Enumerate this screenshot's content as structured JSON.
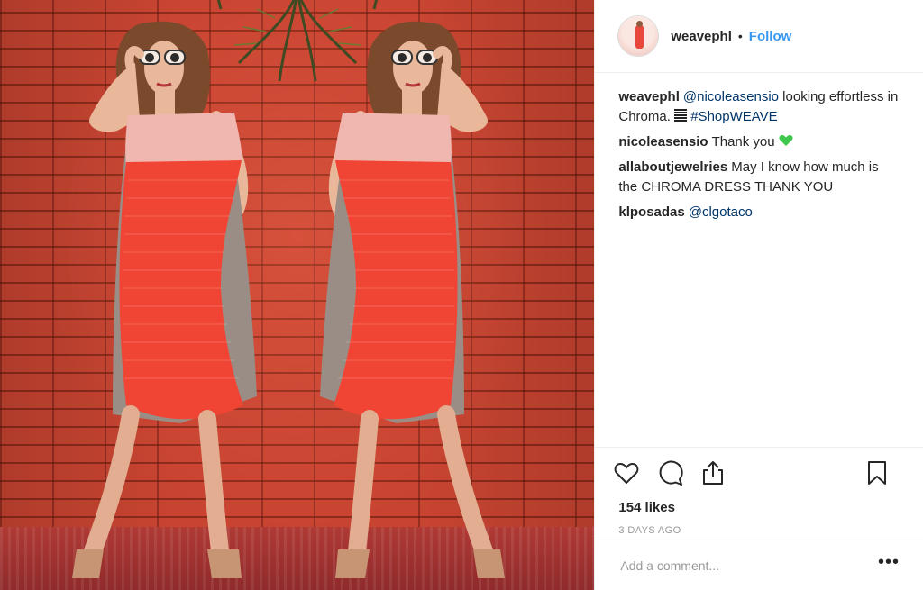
{
  "post": {
    "username": "weavephl",
    "follow_label": "Follow",
    "separator": "•",
    "photo_alt": "Woman in a red and grey pleated dress, mirrored, in front of a red brick wall"
  },
  "comments": [
    {
      "user": "weavephl",
      "parts": [
        {
          "t": "@nicoleasensio",
          "link": true
        },
        {
          "t": " looking effortless in Chroma. ",
          "link": false
        },
        {
          "t": "#ShopWEAVE",
          "link": true
        }
      ],
      "has_bars_icon": true
    },
    {
      "user": "nicoleasensio",
      "text": "Thank you",
      "emoji": "green-heart"
    },
    {
      "user": "allaboutjewelries",
      "text": "May I know how much is the CHROMA DRESS THANK YOU"
    },
    {
      "user": "klposadas",
      "mention": "@clgotaco"
    }
  ],
  "likes": "154 likes",
  "timestamp": "3 DAYS AGO",
  "add_comment": {
    "placeholder": "Add a comment..."
  },
  "more_label": "•••",
  "colors": {
    "link": "#003569",
    "follow": "#3897f0",
    "text": "#262626",
    "muted": "#999999",
    "wall": "#c84431",
    "dress_red": "#f04535"
  },
  "icons": [
    "heart-icon",
    "comment-icon",
    "share-icon",
    "bookmark-icon",
    "more-icon"
  ]
}
